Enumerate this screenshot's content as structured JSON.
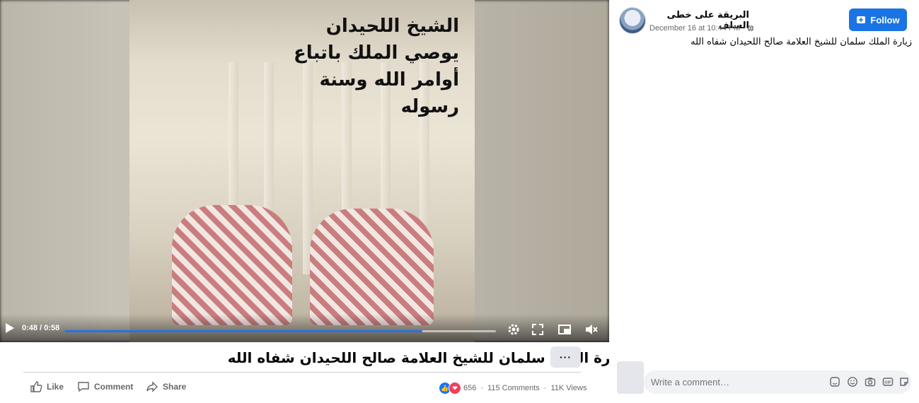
{
  "video": {
    "overlay_lines": [
      "الشيخ اللحيدان",
      "يوصي الملك باتباع",
      "أوامر الله وسنة رسوله"
    ],
    "time": "0:48 / 0:58",
    "progress": 0.83
  },
  "post": {
    "title": "زيارة الملك سلمان للشيخ العلامة صالح اللحيدان شفاه الله",
    "more_label": "···",
    "actions": {
      "like": "Like",
      "comment": "Comment",
      "share": "Share"
    },
    "stats": {
      "reactions": "656",
      "separator": "·",
      "comments": "115 Comments",
      "views": "11K Views"
    }
  },
  "sidebar": {
    "page_name": "البريقة على خطى السلف",
    "date": "December 16 at 10:44 PM ·",
    "follow_label": "Follow",
    "description": "زيارة الملك سلمان للشيخ العلامة صالح اللحيدان شفاه الله",
    "comment_placeholder": "Write a comment…"
  },
  "colors": {
    "accent": "#1b74e4",
    "progress": "#2374e1",
    "like_blue": "#1877f2",
    "love_red": "#f33e58"
  },
  "icons": [
    "play-icon",
    "settings-icon",
    "fullscreen-icon",
    "pip-icon",
    "volume-icon",
    "like-icon",
    "comment-icon",
    "share-icon",
    "globe-icon",
    "follow-icon",
    "sticker-icon",
    "emoji-icon",
    "camera-icon",
    "gif-icon",
    "avatar-sticker-icon"
  ]
}
